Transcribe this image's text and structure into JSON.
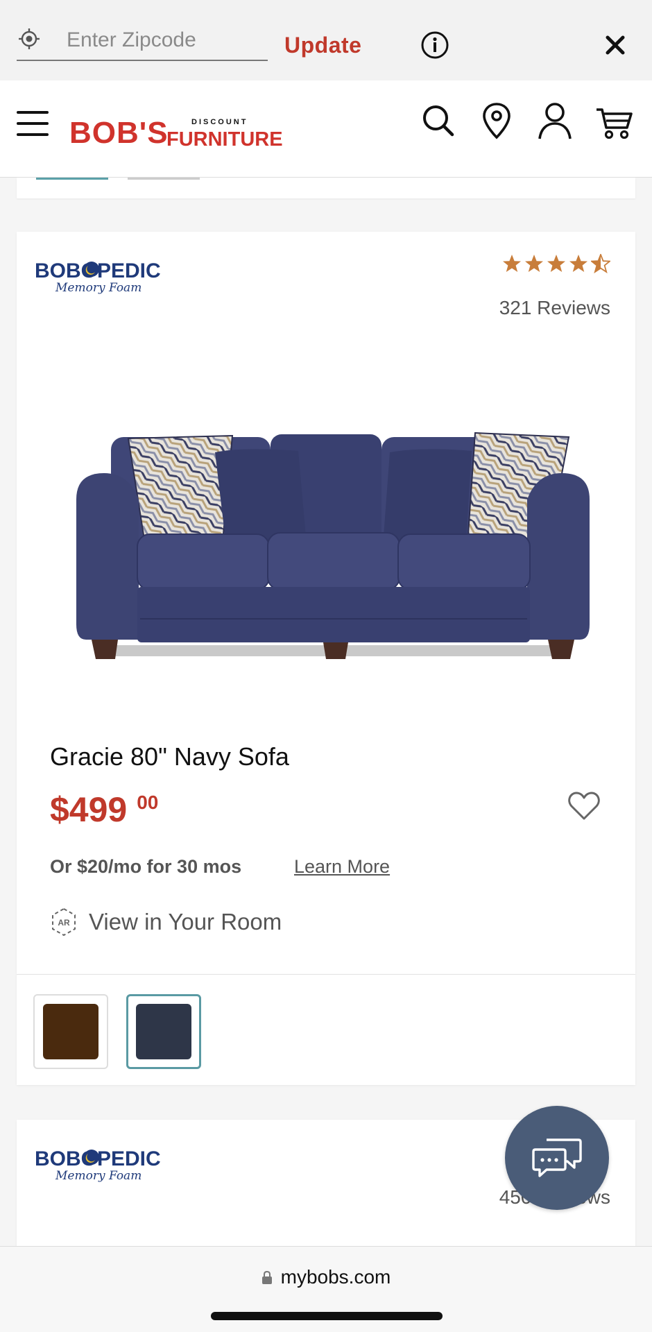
{
  "zipbar": {
    "placeholder": "Enter Zipcode",
    "update_label": "Update"
  },
  "header": {
    "logo_text": "BOB'S",
    "logo_sub_top": "DISCOUNT",
    "logo_sub": "FURNITURE"
  },
  "product": {
    "brand": "BOBOPEDIC",
    "brand_sub": "Memory Foam",
    "rating": 4.5,
    "reviews": "321 Reviews",
    "title": "Gracie 80\" Navy Sofa",
    "price_dollars": "$499",
    "price_cents": "00",
    "financing": "Or $20/mo for 30 mos",
    "learn_more": "Learn More",
    "ar_label": "View in Your Room",
    "ar_icon_text": "AR",
    "swatches": [
      {
        "color": "#4a2a0e",
        "selected": false
      },
      {
        "color": "#2e3648",
        "selected": true
      }
    ]
  },
  "next_product": {
    "brand": "BOBOPEDIC",
    "brand_sub": "Memory Foam",
    "reviews": "450 Reviews"
  },
  "browser": {
    "url": "mybobs.com"
  },
  "colors": {
    "brand_red": "#c0392b",
    "star": "#c87d3a",
    "chat": "#4a5c78",
    "selected_border": "#5a9aa3"
  }
}
